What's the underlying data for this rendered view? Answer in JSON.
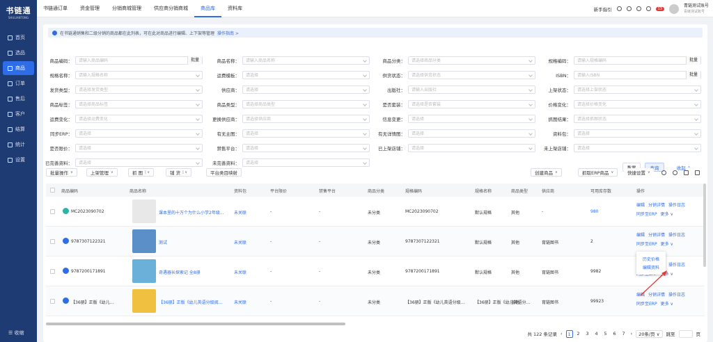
{
  "app": {
    "logo": "书链通",
    "logo_sub": "SHULIANTONG"
  },
  "sidebar": {
    "items": [
      {
        "label": "首页",
        "icon": "home-icon"
      },
      {
        "label": "选品",
        "icon": "select-icon"
      },
      {
        "label": "商品",
        "icon": "goods-icon",
        "active": true
      },
      {
        "label": "订单",
        "icon": "order-icon"
      },
      {
        "label": "售后",
        "icon": "aftersale-icon"
      },
      {
        "label": "客户",
        "icon": "customer-icon"
      },
      {
        "label": "结算",
        "icon": "settle-icon"
      },
      {
        "label": "统计",
        "icon": "stats-icon"
      },
      {
        "label": "设置",
        "icon": "settings-icon"
      }
    ],
    "collapse": "☰ 收缩"
  },
  "tabs": [
    "书链通订单",
    "资金管理",
    "分销商城管理",
    "供应商分销商城",
    "商品库",
    "资料库"
  ],
  "active_tab": "商品库",
  "top": {
    "guide": "新手指引",
    "badge": "13",
    "user_name": "青链测试账号",
    "user_sub": "青链测试账号"
  },
  "notice": {
    "text": "在书链通销售和二级分销的商品都在此列表，可在此对商品进行编辑、上下架等管理",
    "link": "操作指南 >"
  },
  "filters": {
    "r1": [
      {
        "label": "商品编码：",
        "ph": "请输入商品编码",
        "bulk": "批量"
      },
      {
        "label": "商品名称：",
        "ph": "请输入商品名称"
      },
      {
        "label": "商品分类：",
        "ph": "请选择商品分类"
      },
      {
        "label": "规格编码：",
        "ph": "请输入规格编码",
        "bulk": "批量"
      }
    ],
    "r2": [
      {
        "label": "规格名称：",
        "ph": "请输入规格名称"
      },
      {
        "label": "运费模板：",
        "ph": "请选择"
      },
      {
        "label": "供货状态：",
        "ph": "请选择供货状态"
      },
      {
        "label": "ISBN：",
        "ph": "请输入ISBN",
        "bulk": "批量"
      }
    ],
    "r3": [
      {
        "label": "发货类型：",
        "ph": "请选择发货类型"
      },
      {
        "label": "供应商：",
        "ph": "请选择"
      },
      {
        "label": "出版社：",
        "ph": "请输入出版社"
      },
      {
        "label": "上架状态：",
        "ph": "请选择上架状态"
      }
    ],
    "r4": [
      {
        "label": "商品标签：",
        "ph": "请选择商品标签"
      },
      {
        "label": "商品类型：",
        "ph": "请选择商品类型"
      },
      {
        "label": "是否套装：",
        "ph": "请选择是否套装"
      },
      {
        "label": "价格变化：",
        "ph": "请选择价格变化"
      }
    ],
    "r5": [
      {
        "label": "运费变化：",
        "ph": "请选择运费变化"
      },
      {
        "label": "更换供应商：",
        "ph": "请选择供应商"
      },
      {
        "label": "信息变更：",
        "ph": "请选择"
      },
      {
        "label": "抓图结果：",
        "ph": "请选择抓图状态"
      }
    ],
    "r6": [
      {
        "label": "同步ERP：",
        "ph": "请选择"
      },
      {
        "label": "有无主图：",
        "ph": "请选择"
      },
      {
        "label": "有无详情图：",
        "ph": "请选择"
      },
      {
        "label": "资料包：",
        "ph": "请选择"
      }
    ],
    "r7": [
      {
        "label": "是否限价：",
        "ph": "请选择"
      },
      {
        "label": "禁售平台：",
        "ph": "请选择"
      },
      {
        "label": "已上架店铺：",
        "ph": "请选择"
      },
      {
        "label": "未上架店铺：",
        "ph": "请选择"
      }
    ],
    "r8": [
      {
        "label": "已完善资料：",
        "ph": "请选择"
      },
      {
        "label": "未完善资料：",
        "ph": "请选择"
      }
    ],
    "reset": "重置",
    "query": "查询",
    "collapse": "收起 ⌃"
  },
  "toolbar": {
    "bulk": "批量操作",
    "shelve": "上架管理",
    "grab": "抓 图",
    "sync": "铺 货",
    "platform": "平台类目映射",
    "create": "创建商品",
    "erp": "抓取ERP商品",
    "quick": "快捷设置"
  },
  "table": {
    "headers": [
      "商品编码",
      "商品名称",
      "资料包",
      "平台限价",
      "禁售平台",
      "商品分类",
      "规格编码",
      "规格名称",
      "商品类型",
      "供应商",
      "可用库存数",
      "操作"
    ],
    "rows": [
      {
        "code": "MC2023090702",
        "name": "课本里的十万个为什么小学2年级...",
        "pack": "未关联",
        "limit": "-",
        "ban": "-",
        "cat": "未分类",
        "sku": "MC2023090702",
        "spec": "默认规格",
        "type": "其他",
        "supplier": "-",
        "stock": "980"
      },
      {
        "code": "9787307122321",
        "name": "测试",
        "pack": "未关联",
        "limit": "-",
        "ban": "-",
        "cat": "未分类",
        "sku": "9787307122321",
        "spec": "默认规格",
        "type": "其他",
        "supplier": "育链图书",
        "stock": "2"
      },
      {
        "code": "9787200171891",
        "name": "奇遇器长探索记 全8册",
        "pack": "未关联",
        "limit": "-",
        "ban": "-",
        "cat": "未分类",
        "sku": "9787200171891",
        "spec": "默认规格",
        "type": "其他",
        "supplier": "育链图书",
        "stock": "9982"
      },
      {
        "code": "【36册】正版《幼儿...",
        "name": "【36册】正版《幼儿英语分级阅...",
        "pack": "未关联",
        "limit": "-",
        "ban": "-",
        "cat": "未分类",
        "sku": "【36册】正版《幼儿英语分级...",
        "spec": "【36册】正版《幼儿英语分...",
        "type": "其他",
        "supplier": "育链图书",
        "stock": "99923"
      }
    ],
    "ops": {
      "edit": "编辑",
      "dist": "分销详情",
      "log": "操作日志",
      "erp": "同步至ERP",
      "more": "更多 ∨"
    }
  },
  "popup": {
    "item1": "历史价格",
    "item2": "编辑资料"
  },
  "pager": {
    "total": "共 122 条记录",
    "pages": [
      "1",
      "2",
      "3",
      "4",
      "5",
      "6",
      "7"
    ],
    "size": "20条/页",
    "goto": "跳至",
    "unit": "页"
  }
}
